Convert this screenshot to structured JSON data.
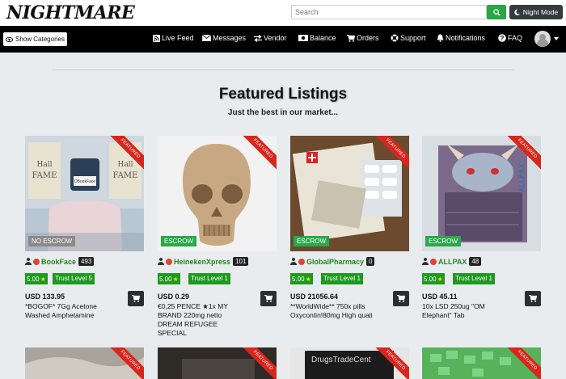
{
  "header": {
    "logo": "NIGHTMARE",
    "search_placeholder": "Search",
    "night_mode_label": "Night Mode"
  },
  "nav": {
    "show_categories": "Show Categories",
    "items": [
      {
        "label": "Live Feed",
        "icon": "rss-icon"
      },
      {
        "label": "Messages",
        "icon": "envelope-icon"
      },
      {
        "label": "Vendor",
        "icon": "exchange-icon"
      },
      {
        "label": "Balance",
        "icon": "money-icon"
      },
      {
        "label": "Orders",
        "icon": "cart-icon"
      },
      {
        "label": "Support",
        "icon": "lifebuoy-icon"
      },
      {
        "label": "Notifications",
        "icon": "bell-icon"
      },
      {
        "label": "FAQ",
        "icon": "question-icon"
      }
    ]
  },
  "page": {
    "title": "Featured Listings",
    "subtitle": "Just the best in our market..."
  },
  "listings": [
    {
      "ribbon": "FEATURED",
      "escrow": "NO ESCROW",
      "vendor": "BookFace",
      "vendor_count": "493",
      "rating": "5.00",
      "trust": "Trust Level 5",
      "price": "USD 133.95",
      "title": "*BOGOF* 7Gg Acetone Washed Amphetamine"
    },
    {
      "ribbon": "FEATURED",
      "escrow": "ESCROW",
      "vendor": "HeinekenXpress",
      "vendor_count": "101",
      "rating": "5.00",
      "trust": "Trust Level 1",
      "price": "USD 0.29",
      "title": "€0,25 PENCE ★1x MY BRAND 220mg netto DREAM REFUGEE SPECIAL"
    },
    {
      "ribbon": "FEATURED",
      "escrow": "ESCROW",
      "vendor": "GlobalPharmacy",
      "vendor_count": "0",
      "rating": "5.00",
      "trust": "Trust Level 1",
      "price": "USD 21056.64",
      "title": "**WorldWide** 750x pills Oxycontin!80mg High quali"
    },
    {
      "ribbon": "FEATURED",
      "escrow": "ESCROW",
      "vendor": "ALLPAX",
      "vendor_count": "48",
      "rating": "5.00",
      "trust": "Trust Level 1",
      "price": "USD 45.11",
      "title": "10x LSD 250ug \"OM Elephant\" Tab"
    }
  ],
  "second_row": [
    {
      "ribbon": "FEATURED"
    },
    {
      "ribbon": "FEATURED"
    },
    {
      "ribbon": "FEATURED",
      "image_text": "DrugsTradeCent"
    },
    {
      "ribbon": "FEATURED"
    }
  ],
  "image_labels": {
    "hall_of_fame": "Hall of FAME",
    "card_label": "DBookFace",
    "allpax": "ALLPAX"
  },
  "colors": {
    "accent_green": "#1d9a1d",
    "ribbon_red": "#d9261c",
    "navbar": "#000000",
    "escrow_green": "#2aa84a",
    "no_escrow_gray": "#8a8a8a"
  }
}
